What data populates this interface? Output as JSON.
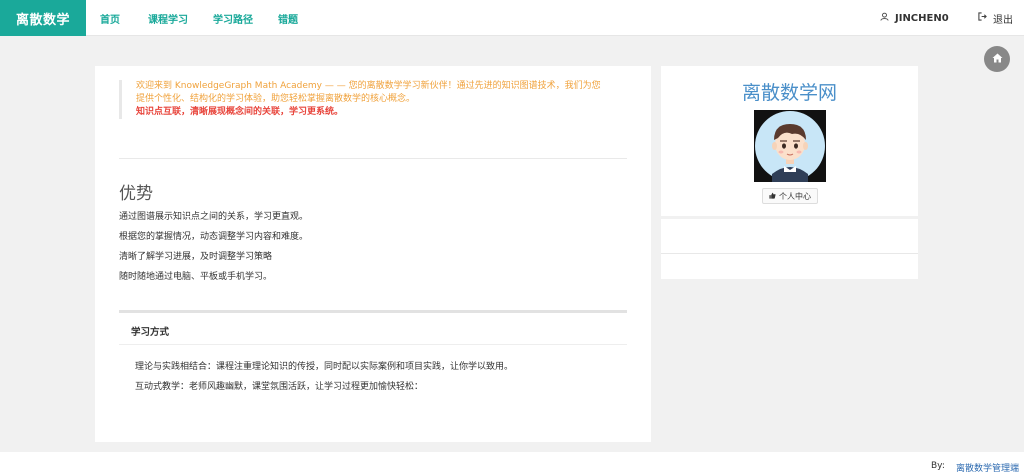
{
  "header": {
    "brand": "离散数学",
    "nav": [
      "首页",
      "课程学习",
      "学习路径",
      "错题"
    ],
    "username": "JINCHEN0",
    "logout": "退出"
  },
  "welcome": {
    "line1": "欢迎来到 KnowledgeGraph Math Academy — — 您的离散数学学习新伙伴！通过先进的知识图谱技术，我们为您提供个性化、结构化的学习体验，助您轻松掌握离散数学的核心概念。",
    "line2": "知识点互联，清晰展现概念间的关联，学习更系统。"
  },
  "advantages": {
    "title": "优势",
    "items": [
      "通过图谱展示知识点之间的关系，学习更直观。",
      "根据您的掌握情况，动态调整学习内容和难度。",
      "清晰了解学习进展，及时调整学习策略",
      "随时随地通过电脑、平板或手机学习。"
    ]
  },
  "study": {
    "title": "学习方式",
    "items": [
      "理论与实践相结合：课程注重理论知识的传授，同时配以实际案例和项目实践，让你学以致用。",
      "互动式教学：老师风趣幽默，课堂氛围活跃，让学习过程更加愉快轻松："
    ]
  },
  "sidebar": {
    "title": "离散数学网",
    "profile_button": "个人中心"
  },
  "footer": {
    "by": "By:",
    "link": "离散数学管理端"
  },
  "colors": {
    "brand": "#1aa99a",
    "welcome_text": "#f0a23c",
    "highlight_text": "#e8453c",
    "side_title": "#4a8fc9"
  }
}
